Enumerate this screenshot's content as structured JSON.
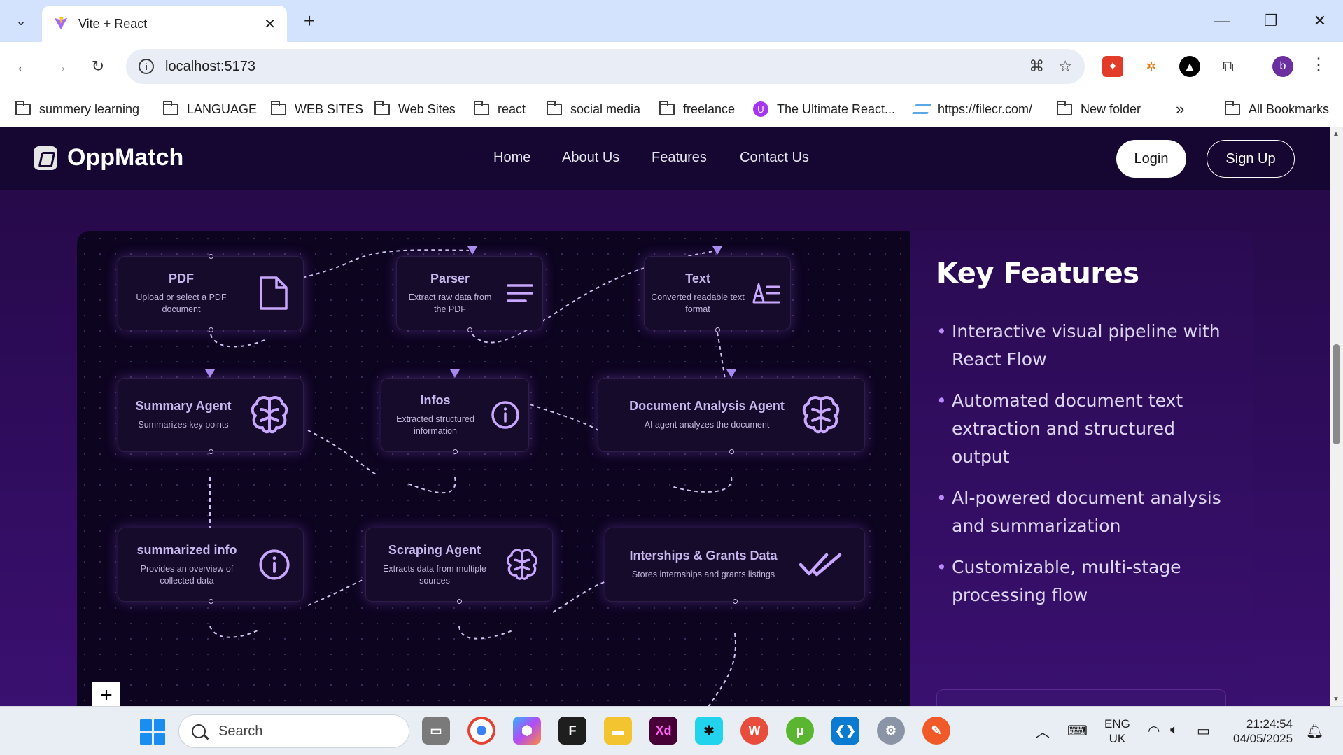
{
  "browser": {
    "tab_title": "Vite + React",
    "url": "localhost:5173",
    "profile_initial": "b",
    "bookmarks": [
      {
        "label": "summery learning",
        "icon": "folder-icon"
      },
      {
        "label": "LANGUAGE",
        "icon": "folder-icon"
      },
      {
        "label": "WEB SITES",
        "icon": "folder-icon"
      },
      {
        "label": "Web Sites",
        "icon": "folder-icon"
      },
      {
        "label": "react",
        "icon": "folder-icon"
      },
      {
        "label": "social media",
        "icon": "folder-icon"
      },
      {
        "label": "freelance",
        "icon": "folder-icon"
      },
      {
        "label": "The Ultimate React...",
        "icon": "udemy-icon"
      },
      {
        "label": "https://filecr.com/",
        "icon": "filecr-icon"
      },
      {
        "label": "New folder",
        "icon": "folder-icon"
      }
    ],
    "overflow_label": "»",
    "all_bookmarks": "All Bookmarks"
  },
  "site": {
    "logo": "OppMatch",
    "nav": [
      "Home",
      "About Us",
      "Features",
      "Contact Us"
    ],
    "login": "Login",
    "signup": "Sign Up"
  },
  "flow": {
    "nodes": [
      {
        "title": "PDF",
        "desc": "Upload or select a PDF document",
        "icon": "document-icon"
      },
      {
        "title": "Parser",
        "desc": "Extract raw data from the PDF",
        "icon": "lines-icon"
      },
      {
        "title": "Text",
        "desc": "Converted readable text format",
        "icon": "text-format-icon"
      },
      {
        "title": "Summary Agent",
        "desc": "Summarizes key points",
        "icon": "brain-icon"
      },
      {
        "title": "Infos",
        "desc": "Extracted structured information",
        "icon": "info-icon"
      },
      {
        "title": "Document Analysis Agent",
        "desc": "AI agent analyzes the document",
        "icon": "brain-icon"
      },
      {
        "title": "summarized info",
        "desc": "Provides an overview of collected data",
        "icon": "info-icon"
      },
      {
        "title": "Scraping Agent",
        "desc": "Extracts data from multiple sources",
        "icon": "brain-icon"
      },
      {
        "title": "Interships & Grants Data",
        "desc": "Stores internships and grants listings",
        "icon": "double-check-icon"
      }
    ],
    "add_label": "+"
  },
  "features": {
    "title": "Key Features",
    "items": [
      "Interactive visual pipeline with React Flow",
      "Automated document text extraction and structured output",
      "AI-powered document analysis and summarization",
      "Customizable, multi-stage processing flow"
    ]
  },
  "taskbar": {
    "search": "Search",
    "lang_top": "ENG",
    "lang_bottom": "UK",
    "time": "21:24:54",
    "date": "04/05/2025"
  },
  "colors": {
    "accent": "#a98ef0",
    "page_bg": "#2c0b57",
    "nav_bg": "#150732"
  }
}
